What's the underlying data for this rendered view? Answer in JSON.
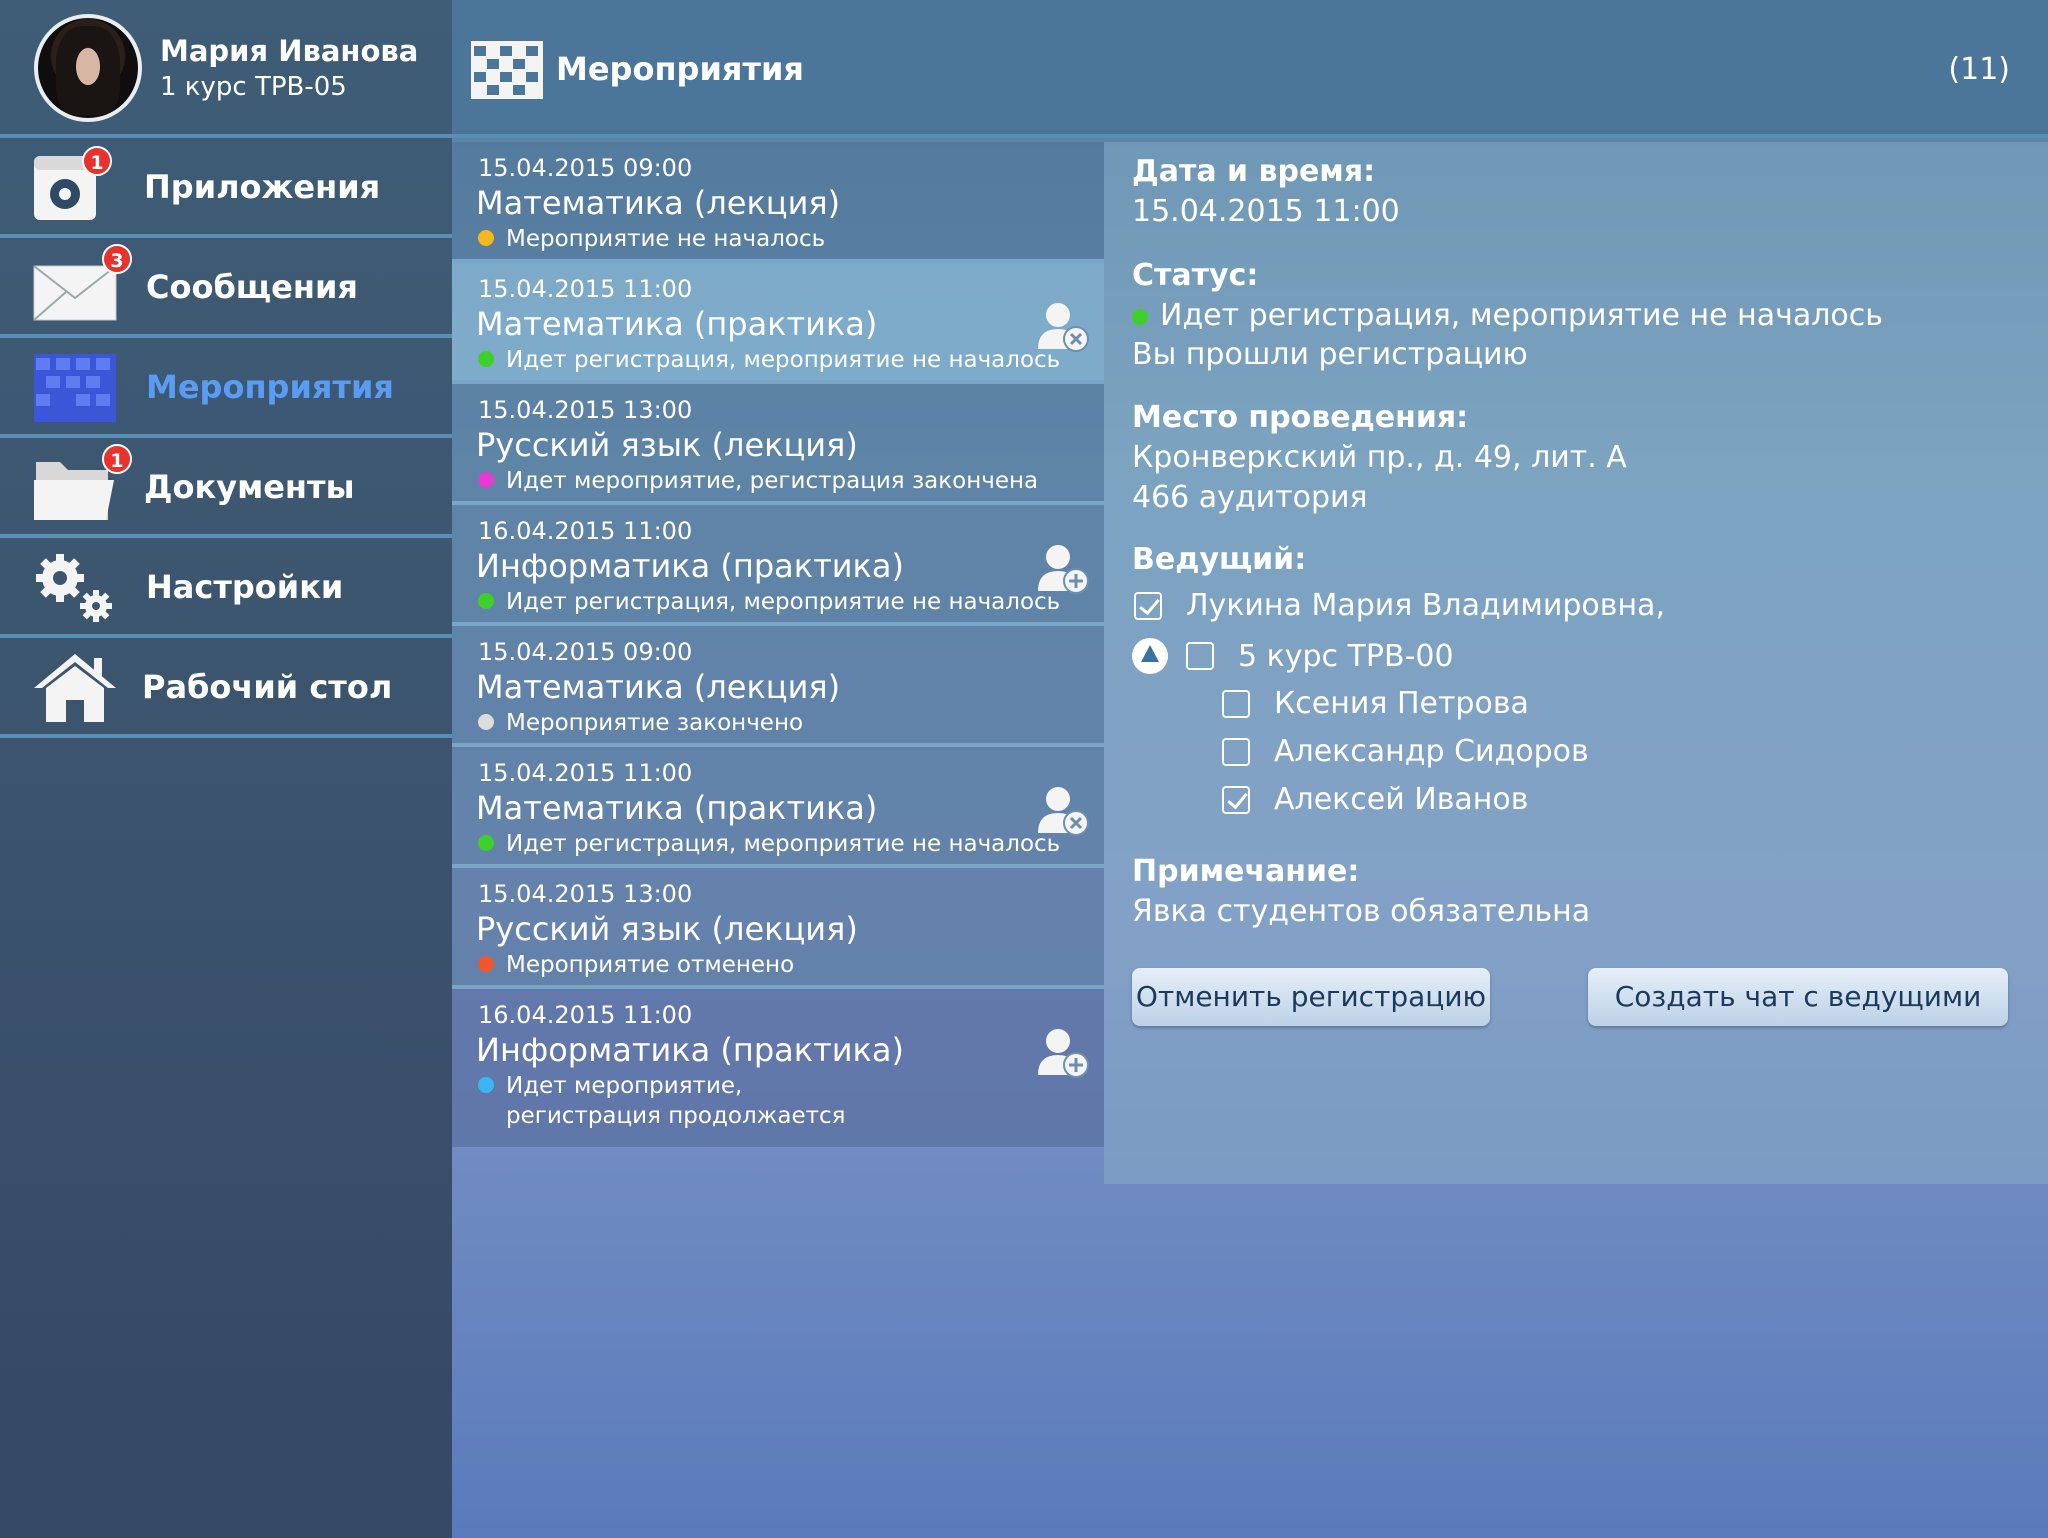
{
  "profile": {
    "name": "Мария Иванова",
    "subtitle": "1 курс ТРВ-05"
  },
  "nav": [
    {
      "label": "Приложения",
      "icon": "apps-icon",
      "badge": "1"
    },
    {
      "label": "Сообщения",
      "icon": "envelope-icon",
      "badge": "3"
    },
    {
      "label": "Мероприятия",
      "icon": "calendar-icon",
      "badge": ""
    },
    {
      "label": "Документы",
      "icon": "folder-icon",
      "badge": "1"
    },
    {
      "label": "Настройки",
      "icon": "gears-icon",
      "badge": ""
    },
    {
      "label": "Рабочий стол",
      "icon": "home-icon",
      "badge": ""
    }
  ],
  "header": {
    "title": "Мероприятия",
    "count": "(11)"
  },
  "events": [
    {
      "datetime": "15.04.2015 09:00",
      "title": "Математика (лекция)",
      "status": "Мероприятие не началось",
      "status_color": "#f5b71f",
      "action": ""
    },
    {
      "datetime": "15.04.2015 11:00",
      "title": "Математика (практика)",
      "status": "Идет регистрация, мероприятие не началось",
      "status_color": "#3fcf2a",
      "action": "user-remove-icon"
    },
    {
      "datetime": "15.04.2015 13:00",
      "title": "Русский язык (лекция)",
      "status": "Идет мероприятие, регистрация закончена",
      "status_color": "#e63ad3",
      "action": ""
    },
    {
      "datetime": "16.04.2015 11:00",
      "title": "Информатика (практика)",
      "status": "Идет регистрация, мероприятие не началось",
      "status_color": "#3fcf2a",
      "action": "user-add-icon"
    },
    {
      "datetime": "15.04.2015 09:00",
      "title": "Математика (лекция)",
      "status": "Мероприятие закончено",
      "status_color": "#dcdcdc",
      "action": ""
    },
    {
      "datetime": "15.04.2015 11:00",
      "title": "Математика (практика)",
      "status": "Идет регистрация, мероприятие не началось",
      "status_color": "#3fcf2a",
      "action": "user-remove-icon"
    },
    {
      "datetime": "15.04.2015 13:00",
      "title": "Русский язык (лекция)",
      "status": "Мероприятие отменено",
      "status_color": "#f0562e",
      "action": ""
    },
    {
      "datetime": "16.04.2015 11:00",
      "title": "Информатика (практика)",
      "status": "Идет мероприятие,",
      "status2": "регистрация продолжается",
      "status_color": "#3cb6f2",
      "action": "user-add-icon"
    }
  ],
  "details": {
    "datetime_label": "Дата и время:",
    "datetime_value": "15.04.2015 11:00",
    "status_label": "Статус:",
    "status_value": "Идет регистрация, мероприятие не началось",
    "status_note": "Вы прошли регистрацию",
    "place_label": "Место проведения:",
    "place_line1": "Кронверкский пр., д. 49, лит. А",
    "place_line2": "466 аудитория",
    "host_label": "Ведущий:",
    "host_name": "Лукина Мария Владимировна,",
    "group_name": "5 курс ТРВ-00",
    "members": [
      {
        "name": "Ксения Петрова",
        "checked": false
      },
      {
        "name": "Александр Сидоров",
        "checked": false
      },
      {
        "name": "Алексей Иванов",
        "checked": true
      }
    ],
    "note_label": "Примечание:",
    "note_value": "Явка студентов обязательна",
    "cancel_button": "Отменить регистрацию",
    "chat_button": "Создать чат с ведущими"
  }
}
